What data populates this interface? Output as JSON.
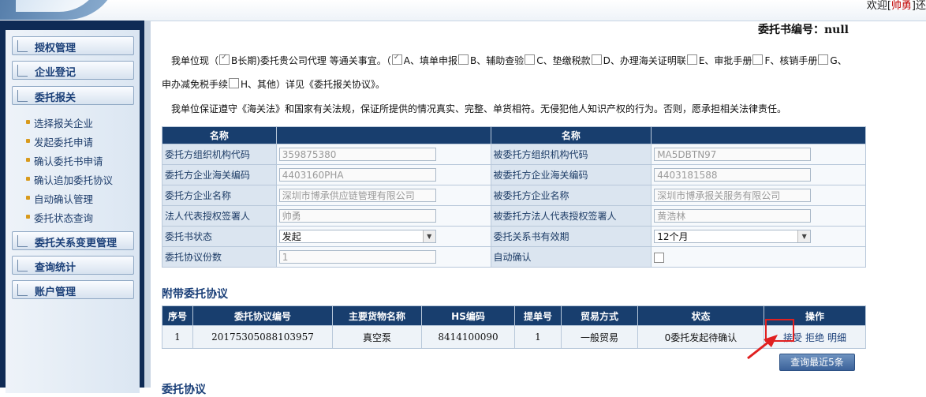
{
  "header": {
    "welcome_prefix": "欢迎[",
    "user": "帅勇",
    "welcome_suffix": "]还"
  },
  "sidebar": {
    "groups": [
      {
        "label": "授权管理"
      },
      {
        "label": "企业登记"
      },
      {
        "label": "委托报关"
      },
      {
        "label": "委托关系变更管理"
      },
      {
        "label": "查询统计"
      },
      {
        "label": "账户管理"
      }
    ],
    "items": [
      {
        "label": "选择报关企业"
      },
      {
        "label": "发起委托申请"
      },
      {
        "label": "确认委托书申请"
      },
      {
        "label": "确认追加委托协议"
      },
      {
        "label": "自动确认管理"
      },
      {
        "label": "委托状态查询"
      }
    ]
  },
  "doc": {
    "number_label": "委托书编号：",
    "number_value": "null"
  },
  "para1": {
    "lead": "我单位现（",
    "b": "B长期)委托贵公司代理 等通关事宜。（",
    "opts": [
      "A、填单申报",
      "B、辅助查验",
      "C、垫缴税款",
      "D、办理海关证明联",
      "E、审批手册",
      "F、核销手册",
      "G、"
    ]
  },
  "para2": {
    "lead": "申办减免税手续",
    "h": "H、其他",
    "tail": "）详见《委托报关协议》。"
  },
  "para3": {
    "text": "我单位保证遵守《海关法》和国家有关法规，保证所提供的情况真实、完整、单货相符。无侵犯他人知识产权的行为。否则，愿承担相关法律责任。"
  },
  "info": {
    "header": [
      "名称",
      "",
      "名称",
      ""
    ],
    "rows": [
      {
        "l1": "委托方组织机构代码",
        "v1": "359875380",
        "l2": "被委托方组织机构代码",
        "v2": "MA5DBTN97"
      },
      {
        "l1": "委托方企业海关编码",
        "v1": "4403160PHA",
        "l2": "被委托方企业海关编码",
        "v2": "4403181588"
      },
      {
        "l1": "委托方企业名称",
        "v1": "深圳市博承供应链管理有限公司",
        "l2": "被委托方企业名称",
        "v2": "深圳市博承报关服务有限公司"
      },
      {
        "l1": "法人代表授权签署人",
        "v1": "帅勇",
        "l2": "被委托方法人代表授权签署人",
        "v2": "黄浩林"
      },
      {
        "l1": "委托书状态",
        "v1": "发起",
        "l2": "委托关系书有效期",
        "v2": "12个月"
      },
      {
        "l1": "委托协议份数",
        "v1": "1",
        "l2": "自动确认",
        "v2": ""
      }
    ]
  },
  "attach": {
    "title": "附带委托协议",
    "columns": [
      "序号",
      "委托协议编号",
      "主要货物名称",
      "HS编码",
      "提单号",
      "贸易方式",
      "状态",
      "操作"
    ],
    "rows": [
      {
        "seq": "1",
        "no": "20175305088103957",
        "goods": "真空泵",
        "hs": "8414100090",
        "bill": "1",
        "trade": "一般贸易",
        "status": "0委托发起待确认"
      }
    ],
    "actions": {
      "accept": "接受",
      "reject": "拒绝",
      "detail": "明细"
    },
    "query_button": "查询最近5条"
  },
  "next_section_title": "委托协议",
  "colors": {
    "sidebar_bg": "#0f2b55",
    "table_header": "#183e6e",
    "highlight": "#e02020"
  }
}
